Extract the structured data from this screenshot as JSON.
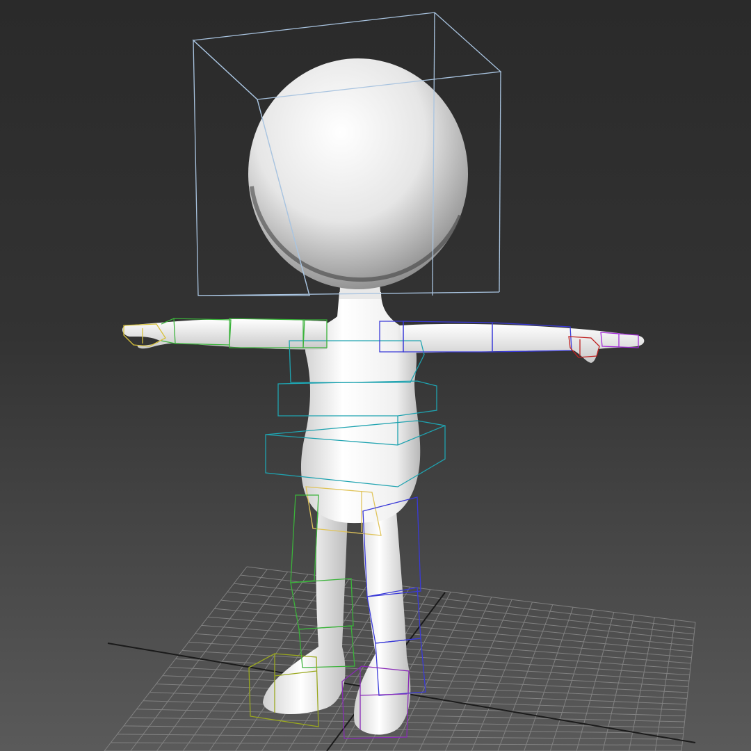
{
  "viewport": {
    "view": "perspective",
    "shading": "default-shading",
    "grid_visible": true,
    "colors": {
      "background_top": "#2a2a2a",
      "background_bottom": "#5a5a5a",
      "grid": "#8a8a8a",
      "grid_axis": "#111111",
      "mesh_light": "#ffffff",
      "mesh_dark": "#9a9a9a",
      "head_box": "#a9c4e0",
      "spine_boxes": "#1fa3b0",
      "left_limb_boxes": "#3bb33b",
      "right_limb_boxes": "#3a3ad8",
      "left_hand_box": "#d8c23a",
      "right_hand_box": "#c02020",
      "fingers_right": "#a32bd8",
      "left_foot_box": "#9aa81e",
      "right_foot_box": "#8a2ab8",
      "pelvis_box": "#e0c45a"
    }
  },
  "scene": {
    "object": "cartoon-character-mesh",
    "pose": "t-pose",
    "rig": "biped-bounding-boxes"
  }
}
